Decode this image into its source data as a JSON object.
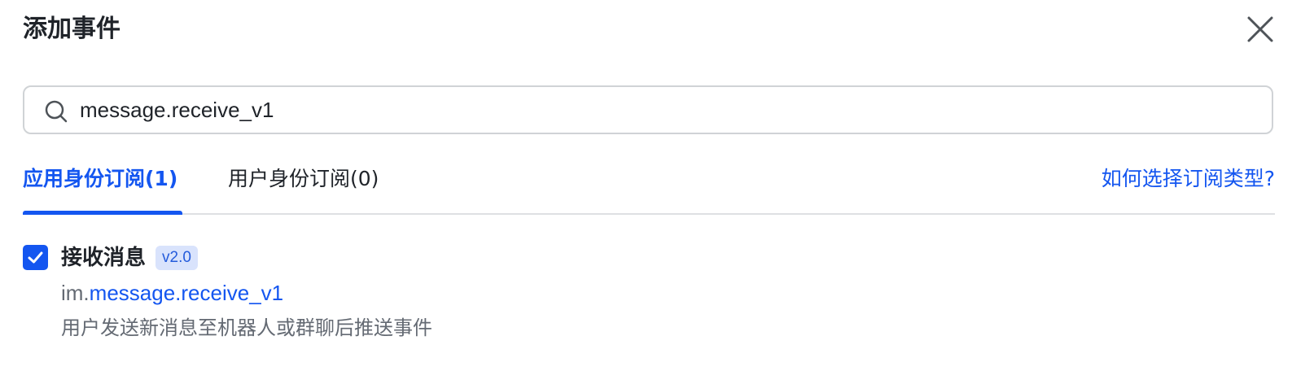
{
  "dialog": {
    "title": "添加事件",
    "close_icon": "close-icon"
  },
  "search": {
    "icon": "search-icon",
    "value": "message.receive_v1",
    "placeholder": ""
  },
  "tabs": [
    {
      "label": "应用身份订阅(1)",
      "active": true
    },
    {
      "label": "用户身份订阅(0)",
      "active": false
    }
  ],
  "help_link": "如何选择订阅类型?",
  "events": [
    {
      "checked": true,
      "name": "接收消息",
      "version": "v2.0",
      "key_prefix": "im.",
      "key": "message.receive_v1",
      "description": "用户发送新消息至机器人或群聊后推送事件"
    }
  ],
  "colors": {
    "accent": "#1456f0",
    "text_primary": "#1f2329",
    "text_secondary": "#646a73",
    "badge_bg": "#d9e3fc"
  }
}
